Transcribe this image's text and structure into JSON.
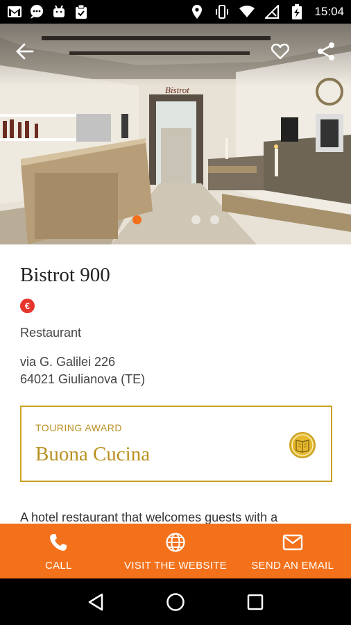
{
  "status_bar": {
    "time": "15:04",
    "left_icons": [
      "gmail-icon",
      "chat-icon",
      "android-icon",
      "clipboard-icon"
    ],
    "right_icons": [
      "location-icon",
      "vibrate-icon",
      "wifi-icon",
      "no-signal-icon",
      "battery-charging-icon"
    ]
  },
  "hero": {
    "sign_text": "Bistrot",
    "carousel_total": 3,
    "carousel_active": 1,
    "toolbar_icons": [
      "back-arrow-icon",
      "heart-icon",
      "share-icon"
    ]
  },
  "venue": {
    "name": "Bistrot 900",
    "price_symbol": "€",
    "category": "Restaurant",
    "address_line1": "via G. Galilei 226",
    "address_line2": "64021 Giulianova (TE)"
  },
  "award": {
    "label": "TOURING AWARD",
    "name": "Buona Cucina",
    "icon": "award-book-icon"
  },
  "description": "A hotel restaurant that welcomes guests with a",
  "actions": [
    {
      "label": "CALL",
      "icon": "phone-icon"
    },
    {
      "label": "VISIT THE WEBSITE",
      "icon": "globe-icon"
    },
    {
      "label": "SEND AN EMAIL",
      "icon": "mail-icon"
    }
  ],
  "colors": {
    "accent": "#f4711b",
    "award_gold": "#c9a227",
    "price_red": "#e5352c"
  },
  "nav": [
    "back-triangle-icon",
    "home-circle-icon",
    "recents-square-icon"
  ]
}
